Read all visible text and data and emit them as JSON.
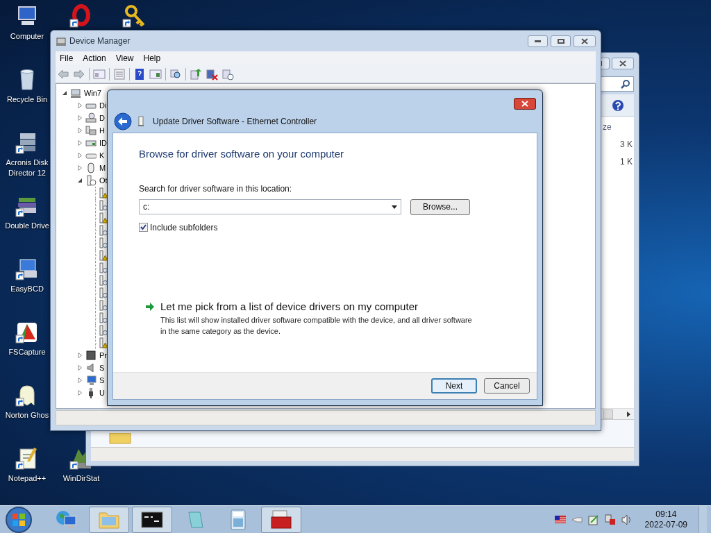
{
  "desktop_icons": [
    {
      "label": "Computer",
      "kind": "computer",
      "shortcut": false
    },
    {
      "label": "Recycle Bin",
      "kind": "recycle-bin",
      "shortcut": false
    },
    {
      "label": "Acronis Disk Director 12",
      "kind": "disk-stack",
      "shortcut": true
    },
    {
      "label": "Double Drive",
      "kind": "books",
      "shortcut": true
    },
    {
      "label": "EasyBCD",
      "kind": "monitor",
      "shortcut": true
    },
    {
      "label": "FSCapture",
      "kind": "triangle",
      "shortcut": true
    },
    {
      "label": "Norton Ghos",
      "kind": "ghost",
      "shortcut": true
    },
    {
      "label": "Notepad++",
      "kind": "notepad",
      "shortcut": true
    },
    {
      "kind": "ring",
      "shortcut": true
    },
    {
      "label": "WinDirStat",
      "kind": "tree",
      "shortcut": true
    },
    {
      "kind": "key",
      "shortcut": true
    }
  ],
  "explorer": {
    "column_header": "ze",
    "sizes": [
      "3 K",
      "1 K"
    ]
  },
  "device_manager": {
    "title": "Device Manager",
    "menu": [
      "File",
      "Action",
      "View",
      "Help"
    ],
    "tree": {
      "label": "Win7",
      "kind": "computer",
      "expanded": true,
      "children": [
        {
          "label": "Di",
          "kind": "drive",
          "expanded": false
        },
        {
          "label": "D",
          "kind": "dvd",
          "expanded": false
        },
        {
          "label": "H",
          "kind": "hid",
          "expanded": false
        },
        {
          "label": "ID",
          "kind": "ide",
          "expanded": false
        },
        {
          "label": "K",
          "kind": "keyboard",
          "expanded": false
        },
        {
          "label": "M",
          "kind": "mouse",
          "expanded": false
        },
        {
          "label": "Ot",
          "kind": "other",
          "expanded": true,
          "children": [
            {
              "kind": "device",
              "warning": true
            },
            {
              "kind": "device",
              "warning": false
            },
            {
              "kind": "device",
              "warning": true
            },
            {
              "kind": "device",
              "warning": false
            },
            {
              "kind": "device",
              "warning": false
            },
            {
              "kind": "device",
              "warning": true
            },
            {
              "kind": "device",
              "warning": false
            },
            {
              "kind": "device",
              "warning": false
            },
            {
              "kind": "device",
              "warning": false
            },
            {
              "kind": "device",
              "warning": false
            },
            {
              "kind": "device",
              "warning": false
            },
            {
              "kind": "device",
              "warning": false
            },
            {
              "kind": "device",
              "warning": true
            }
          ]
        },
        {
          "label": "Pr",
          "kind": "processor",
          "expanded": false
        },
        {
          "label": "S",
          "kind": "sound",
          "expanded": false
        },
        {
          "label": "S",
          "kind": "system",
          "expanded": false
        },
        {
          "label": "U",
          "kind": "usb",
          "expanded": false
        }
      ]
    }
  },
  "dialog": {
    "title": "Update Driver Software - Ethernet Controller",
    "heading": "Browse for driver software on your computer",
    "field_label": "Search for driver software in this location:",
    "location": "c:",
    "browse_button": "Browse...",
    "include_subfolders": {
      "label": "Include subfolders",
      "checked": true
    },
    "pick_link": {
      "label": "Let me pick from a list of device drivers on my computer",
      "description": "This list will show installed driver software compatible with the device, and all driver software in the same category as the device."
    },
    "buttons": [
      {
        "label": "Next",
        "default": true
      },
      {
        "label": "Cancel",
        "default": false
      }
    ]
  },
  "taskbar": {
    "apps": [
      {
        "kind": "network",
        "open": false
      },
      {
        "kind": "folder",
        "open": true
      },
      {
        "kind": "console",
        "open": true
      },
      {
        "kind": "notepad",
        "open": false
      },
      {
        "kind": "calculator",
        "open": false
      },
      {
        "kind": "toolbox",
        "open": true
      }
    ],
    "time": "09:14",
    "date": "2022-07-09"
  }
}
